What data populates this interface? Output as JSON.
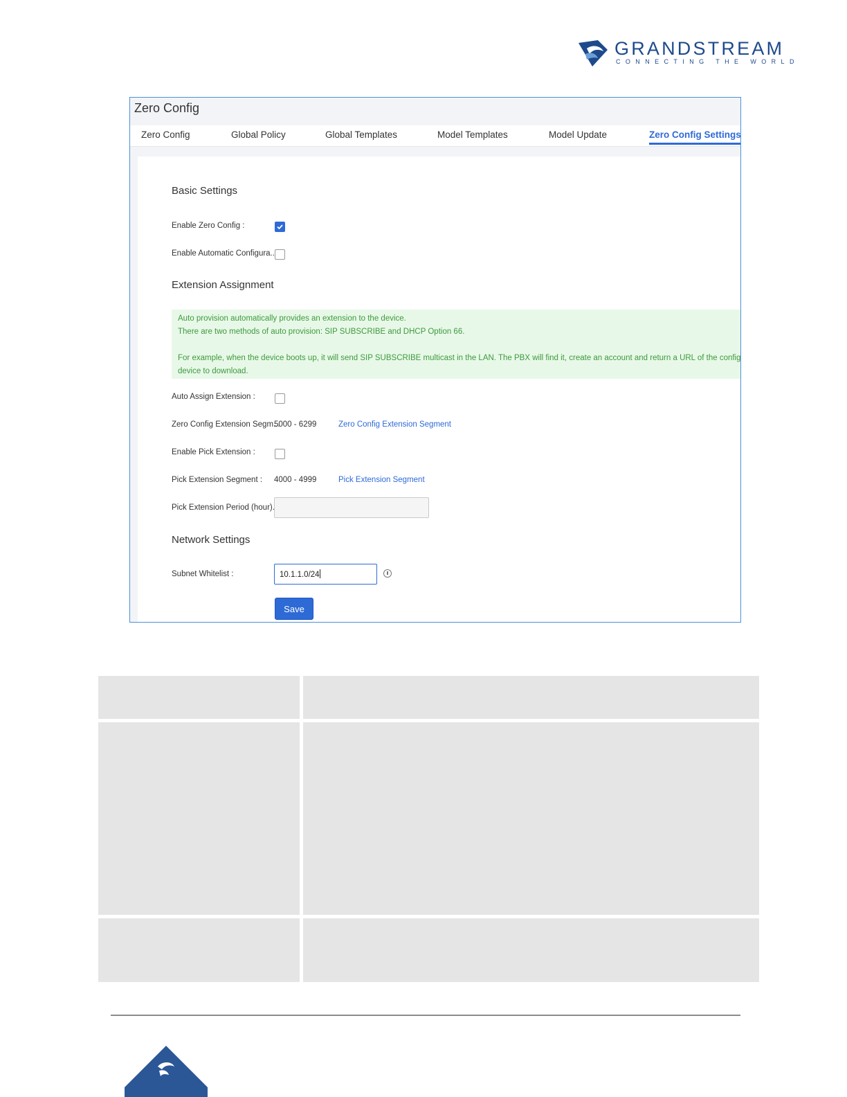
{
  "brand": {
    "name": "GRANDSTREAM",
    "tagline": "CONNECTING THE WORLD",
    "color": "#1e4a8c"
  },
  "screenshot": {
    "title": "Zero Config",
    "tabs": [
      {
        "label": "Zero Config",
        "active": false
      },
      {
        "label": "Global Policy",
        "active": false
      },
      {
        "label": "Global Templates",
        "active": false
      },
      {
        "label": "Model Templates",
        "active": false
      },
      {
        "label": "Model Update",
        "active": false
      },
      {
        "label": "Zero Config Settings",
        "active": true
      }
    ],
    "basic_settings": {
      "title": "Basic Settings",
      "enable_zero_config_label": "Enable Zero Config :",
      "enable_zero_config_checked": true,
      "enable_auto_config_label": "Enable Automatic Configura...",
      "enable_auto_config_checked": false
    },
    "extension_assignment": {
      "title": "Extension Assignment",
      "note_lines": [
        "Auto provision automatically provides an extension to the device.",
        "There are two methods of auto provision: SIP SUBSCRIBE and DHCP Option 66.",
        "For example, when the device boots up, it will send SIP SUBSCRIBE multicast in the LAN. The PBX will find it, create an account and return a URL of the config file f",
        "device to download."
      ],
      "auto_assign_label": "Auto Assign Extension :",
      "auto_assign_checked": false,
      "segment_label": "Zero Config Extension Segm...",
      "segment_value": "5000 - 6299",
      "segment_link": "Zero Config Extension Segment",
      "enable_pick_label": "Enable Pick Extension :",
      "enable_pick_checked": false,
      "pick_segment_label": "Pick Extension Segment :",
      "pick_segment_value": "4000 - 4999",
      "pick_segment_link": "Pick Extension Segment",
      "pick_period_label": "Pick Extension Period (hour)...",
      "pick_period_value": ""
    },
    "network_settings": {
      "title": "Network Settings",
      "subnet_label": "Subnet Whitelist :",
      "subnet_value": "10.1.1.0/24"
    },
    "save_label": "Save",
    "accent_color": "#2e6ad6"
  }
}
